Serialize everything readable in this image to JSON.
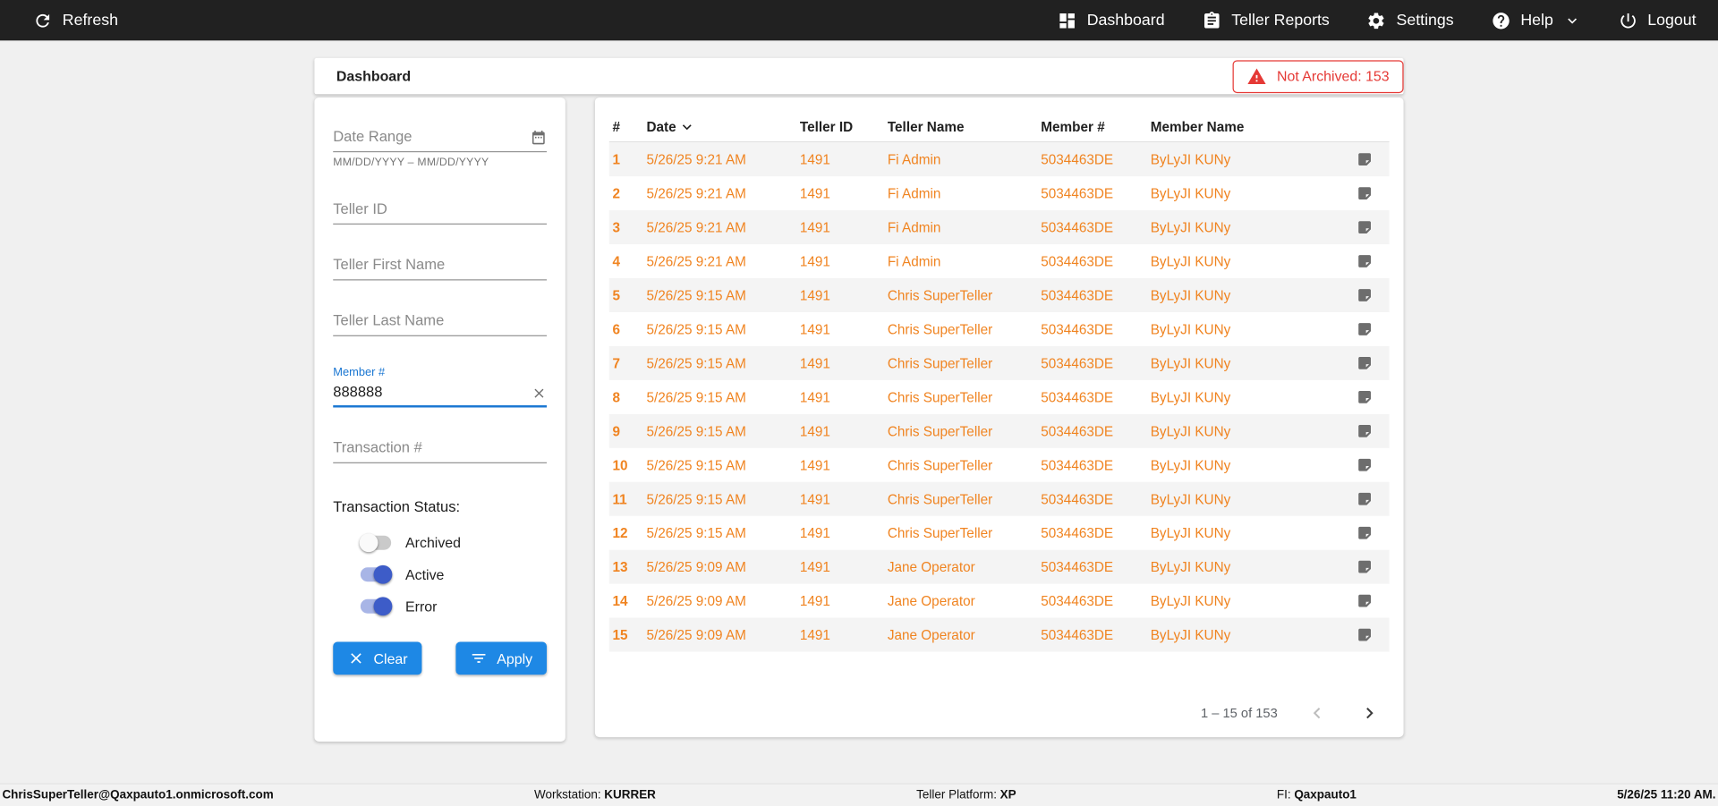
{
  "colors": {
    "topbar_bg": "#212121",
    "accent_orange": "#f08421",
    "accent_blue": "#1e88e5",
    "toggle_blue": "#3d5cc8",
    "alert_red": "#e53935",
    "focus_blue": "#1976d2"
  },
  "topbar": {
    "refresh_label": "Refresh",
    "nav": [
      {
        "label": "Dashboard"
      },
      {
        "label": "Teller Reports"
      },
      {
        "label": "Settings"
      },
      {
        "label": "Help"
      },
      {
        "label": "Logout"
      }
    ]
  },
  "header": {
    "title": "Dashboard",
    "alert": "Not Archived: 153"
  },
  "filters": {
    "date_range_placeholder": "Date Range",
    "date_range_helper": "MM/DD/YYYY – MM/DD/YYYY",
    "teller_id_placeholder": "Teller ID",
    "teller_first_placeholder": "Teller First Name",
    "teller_last_placeholder": "Teller Last Name",
    "member_label": "Member #",
    "member_value": "888888",
    "transaction_placeholder": "Transaction #",
    "status_label": "Transaction Status:",
    "toggles": [
      {
        "label": "Archived",
        "on": false
      },
      {
        "label": "Active",
        "on": true
      },
      {
        "label": "Error",
        "on": true
      }
    ],
    "clear_label": "Clear",
    "apply_label": "Apply"
  },
  "table": {
    "columns": [
      "#",
      "Date",
      "Teller ID",
      "Teller Name",
      "Member #",
      "Member Name"
    ],
    "rows": [
      {
        "num": "1",
        "date": "5/26/25 9:21 AM",
        "teller_id": "1491",
        "teller_name": "Fi Admin",
        "member_number": "5034463DE",
        "member_name": "ByLyJI KUNy"
      },
      {
        "num": "2",
        "date": "5/26/25 9:21 AM",
        "teller_id": "1491",
        "teller_name": "Fi Admin",
        "member_number": "5034463DE",
        "member_name": "ByLyJI KUNy"
      },
      {
        "num": "3",
        "date": "5/26/25 9:21 AM",
        "teller_id": "1491",
        "teller_name": "Fi Admin",
        "member_number": "5034463DE",
        "member_name": "ByLyJI KUNy"
      },
      {
        "num": "4",
        "date": "5/26/25 9:21 AM",
        "teller_id": "1491",
        "teller_name": "Fi Admin",
        "member_number": "5034463DE",
        "member_name": "ByLyJI KUNy"
      },
      {
        "num": "5",
        "date": "5/26/25 9:15 AM",
        "teller_id": "1491",
        "teller_name": "Chris SuperTeller",
        "member_number": "5034463DE",
        "member_name": "ByLyJI KUNy"
      },
      {
        "num": "6",
        "date": "5/26/25 9:15 AM",
        "teller_id": "1491",
        "teller_name": "Chris SuperTeller",
        "member_number": "5034463DE",
        "member_name": "ByLyJI KUNy"
      },
      {
        "num": "7",
        "date": "5/26/25 9:15 AM",
        "teller_id": "1491",
        "teller_name": "Chris SuperTeller",
        "member_number": "5034463DE",
        "member_name": "ByLyJI KUNy"
      },
      {
        "num": "8",
        "date": "5/26/25 9:15 AM",
        "teller_id": "1491",
        "teller_name": "Chris SuperTeller",
        "member_number": "5034463DE",
        "member_name": "ByLyJI KUNy"
      },
      {
        "num": "9",
        "date": "5/26/25 9:15 AM",
        "teller_id": "1491",
        "teller_name": "Chris SuperTeller",
        "member_number": "5034463DE",
        "member_name": "ByLyJI KUNy"
      },
      {
        "num": "10",
        "date": "5/26/25 9:15 AM",
        "teller_id": "1491",
        "teller_name": "Chris SuperTeller",
        "member_number": "5034463DE",
        "member_name": "ByLyJI KUNy"
      },
      {
        "num": "11",
        "date": "5/26/25 9:15 AM",
        "teller_id": "1491",
        "teller_name": "Chris SuperTeller",
        "member_number": "5034463DE",
        "member_name": "ByLyJI KUNy"
      },
      {
        "num": "12",
        "date": "5/26/25 9:15 AM",
        "teller_id": "1491",
        "teller_name": "Chris SuperTeller",
        "member_number": "5034463DE",
        "member_name": "ByLyJI KUNy"
      },
      {
        "num": "13",
        "date": "5/26/25 9:09 AM",
        "teller_id": "1491",
        "teller_name": "Jane Operator",
        "member_number": "5034463DE",
        "member_name": "ByLyJI KUNy"
      },
      {
        "num": "14",
        "date": "5/26/25 9:09 AM",
        "teller_id": "1491",
        "teller_name": "Jane Operator",
        "member_number": "5034463DE",
        "member_name": "ByLyJI KUNy"
      },
      {
        "num": "15",
        "date": "5/26/25 9:09 AM",
        "teller_id": "1491",
        "teller_name": "Jane Operator",
        "member_number": "5034463DE",
        "member_name": "ByLyJI KUNy"
      }
    ],
    "pagination_label": "1 – 15 of 153"
  },
  "footer": {
    "user": "ChrisSuperTeller@Qaxpauto1.onmicrosoft.com",
    "workstation_label": "Workstation:",
    "workstation_value": "KURRER",
    "platform_label": "Teller Platform:",
    "platform_value": "XP",
    "fi_label": "FI:",
    "fi_value": "Qaxpauto1",
    "datetime": "5/26/25 11:20 AM."
  }
}
